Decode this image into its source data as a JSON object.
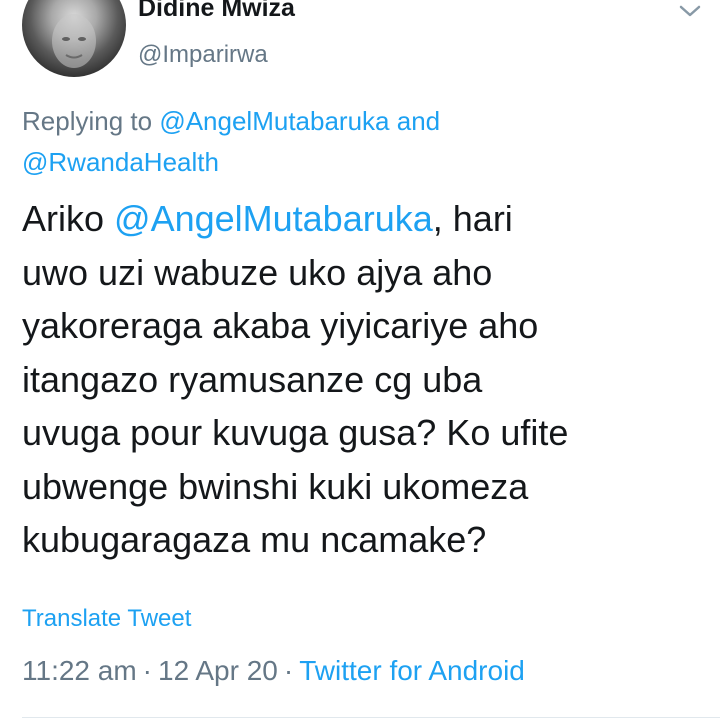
{
  "author": {
    "display_name": "Didine Mwiza",
    "handle": "@Imparirwa"
  },
  "reply": {
    "prefix": "Replying to",
    "mention_1": "@AngelMutabaruka",
    "joiner": "and",
    "mention_2": "@RwandaHealth"
  },
  "tweet": {
    "line_1_prefix": "Ariko ",
    "line_1_mention": "@AngelMutabaruka",
    "line_1_suffix": ", hari",
    "line_2": "uwo uzi wabuze uko ajya aho",
    "line_3": "yakoreraga akaba yiyicariye aho",
    "line_4": "itangazo ryamusanze cg uba",
    "line_5": "uvuga pour kuvuga gusa? Ko ufite",
    "line_6": "ubwenge bwinshi kuki ukomeza",
    "line_7": "kubugaragaza mu ncamake?"
  },
  "translate_label": "Translate Tweet",
  "meta": {
    "time": "11:22 am",
    "separator": "·",
    "date": "12 Apr 20",
    "source": "Twitter for Android"
  },
  "icons": {
    "menu": "chevron-down-icon"
  },
  "colors": {
    "link": "#1da1f2",
    "secondary_text": "#657786",
    "primary_text": "#14171a",
    "divider": "#e1e8ed"
  }
}
